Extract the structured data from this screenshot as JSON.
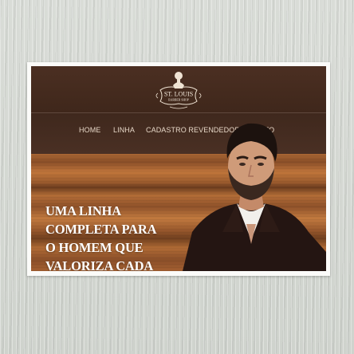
{
  "brand": {
    "name_line1": "ST. LOUIS",
    "name_line2": "BARBER SHOP"
  },
  "nav": {
    "items": [
      {
        "label": "HOME"
      },
      {
        "label": "LINHA"
      },
      {
        "label": "CADASTRO REVENDEDOR"
      },
      {
        "label": "CONTATO"
      }
    ]
  },
  "hero": {
    "lines": [
      "UMA LINHA",
      "COMPLETA PARA",
      "O HOMEM QUE",
      "VALORIZA CADA"
    ]
  },
  "colors": {
    "header_bg": "#45291d",
    "nav_text": "#e6d7c7",
    "hero_text": "#ffffff",
    "wood_light": "#c27a3f",
    "wood_dark": "#6d3d1f"
  }
}
